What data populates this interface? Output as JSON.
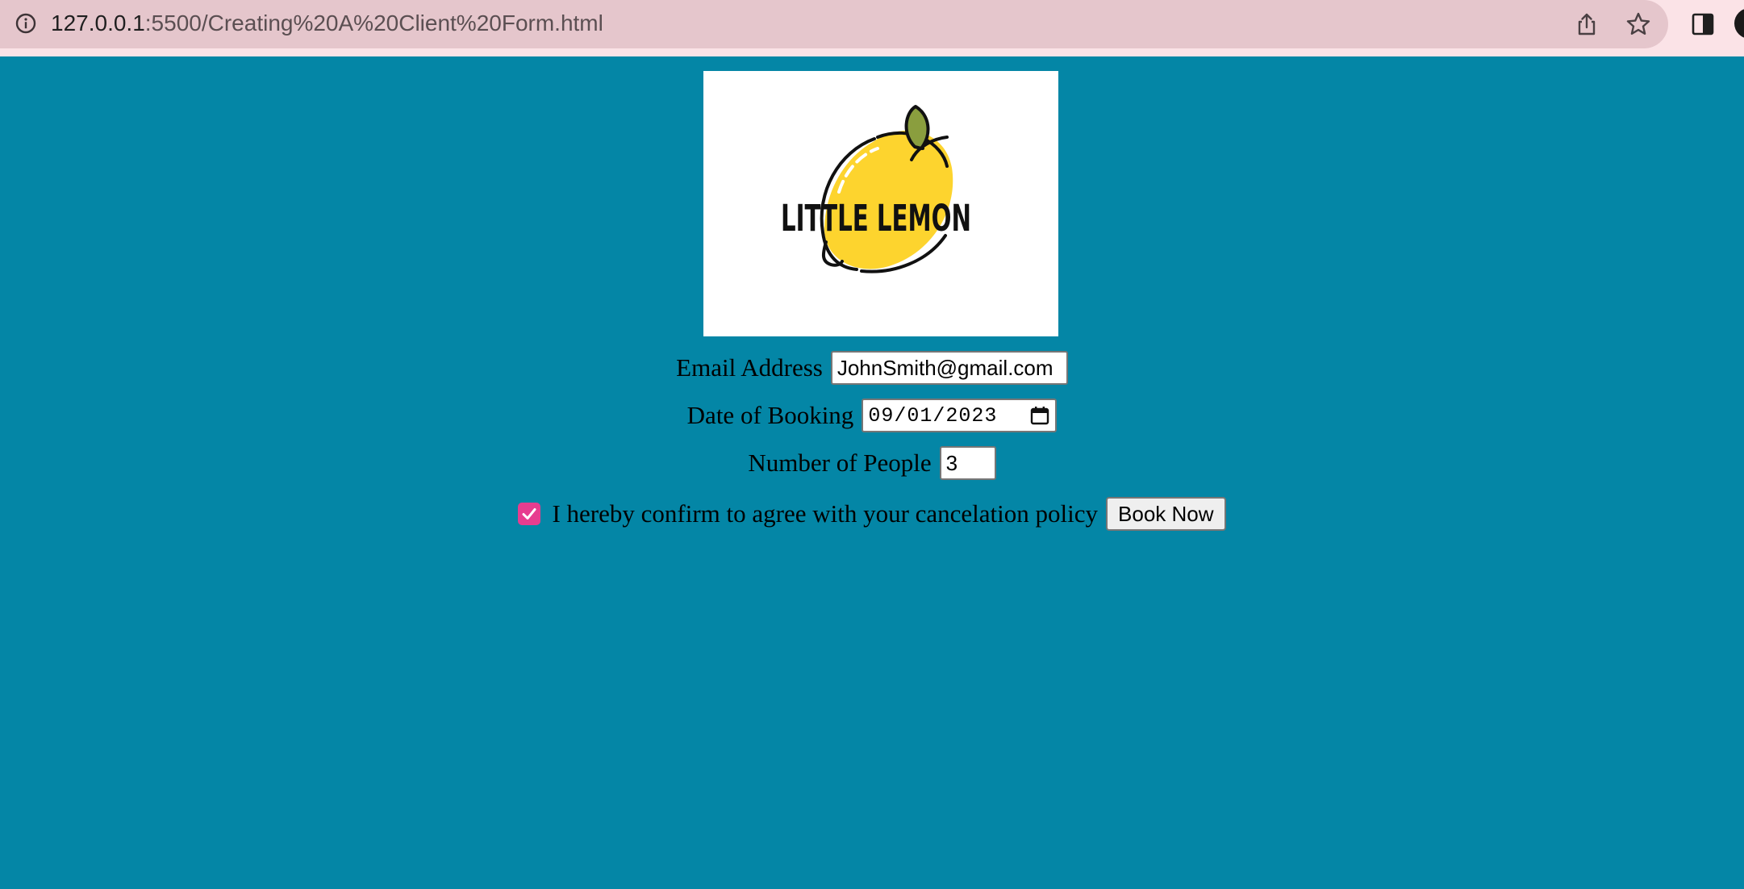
{
  "browser": {
    "url_host": "127.0.0.1",
    "url_path": ":5500/Creating%20A%20Client%20Form.html",
    "icons": [
      "site-info-icon",
      "share-icon",
      "star-icon",
      "side-panel-icon",
      "profile-avatar"
    ]
  },
  "logo": {
    "text": "LITTLE LEMON",
    "lemon_color": "#fdd42e",
    "leaf_color": "#8a9e3e"
  },
  "form": {
    "email": {
      "label": "Email Address",
      "value": "JohnSmith@gmail.com"
    },
    "date": {
      "label": "Date of Booking",
      "value": "09/01/2023"
    },
    "people": {
      "label": "Number of People",
      "value": "3"
    },
    "confirm": {
      "label": "I hereby confirm to agree with your cancelation policy",
      "checked": true
    },
    "submit_label": "Book Now"
  },
  "colors": {
    "page_background": "#0486a6",
    "checkbox_accent": "#e73d8f",
    "browser_bar": "#e5c6cc"
  }
}
